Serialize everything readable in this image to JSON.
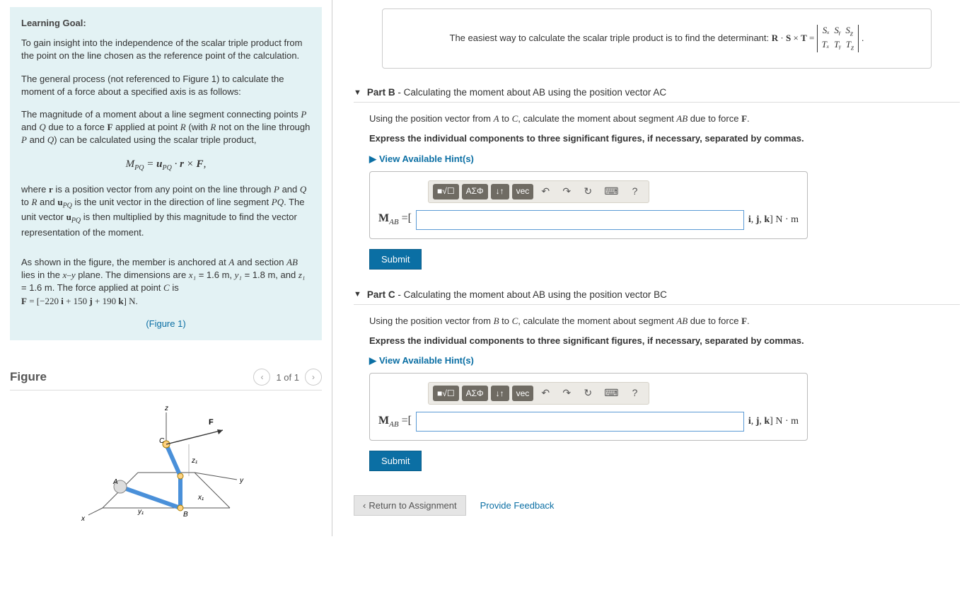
{
  "left": {
    "heading": "Learning Goal:",
    "p1": "To gain insight into the independence of the scalar triple product from the point on the line chosen as the reference point of the calculation.",
    "p2": "The general process (not referenced to Figure 1) to calculate the moment of a force about a specified axis is as follows:",
    "p3a": "The magnitude of a moment about a line segment connecting points ",
    "p3b": " and ",
    "p3c": " due to a force ",
    "p3d": " applied at point ",
    "p3e": " (with ",
    "p3f": " not on the line through ",
    "p3g": " and ",
    "p3h": ") can be calculated using the scalar triple product,",
    "it_P": "P",
    "it_Q": "Q",
    "it_R": "R",
    "it_F": "F",
    "formula": "M_{PQ} = u_{PQ} · r × F,",
    "p4a": "where ",
    "p4b": " is a position vector from any point on the line through ",
    "p4c": " to ",
    "p4d": " and ",
    "p4e": " is the unit vector in the direction of line segment ",
    "p4f": ". The unit vector ",
    "p4g": " is then multiplied by this magnitude to find the vector representation of the moment.",
    "it_r": "r",
    "it_PQ": "PQ",
    "it_uPQ": "u_{PQ}",
    "p5a": "As shown in the figure, the member is anchored at ",
    "p5b": " and section ",
    "p5c": " lies in the ",
    "p5d": " plane. The dimensions are ",
    "p5e": " = 1.6 m, ",
    "p5f": " = 1.8 m, and ",
    "p5g": " = 1.6 m. The force applied at point ",
    "p5h": " is",
    "it_A": "A",
    "it_AB": "AB",
    "it_xy": "x–y",
    "it_x1": "x₁",
    "it_y1": "y₁",
    "it_z1": "z₁",
    "it_C": "C",
    "force_eq": "F = [−220 i + 150 j + 190 k] N.",
    "figure_link": "(Figure 1)",
    "figure_title": "Figure",
    "pager": "1 of 1"
  },
  "right": {
    "hint_intro": "The easiest way to calculate the scalar triple product is to find the determinant: ",
    "hint_eq": "R · S × T =",
    "det_row1": [
      "Sₓ",
      "Sᵧ",
      "S_z"
    ],
    "det_row2": [
      "Tₓ",
      "Tᵧ",
      "T_z"
    ],
    "partB": {
      "label": "Part B",
      "title": " - Calculating the moment about AB using the position vector AC",
      "q_a": "Using the position vector from ",
      "q_b": " to ",
      "q_c": ", calculate the moment about segment ",
      "q_d": " due to force ",
      "q_e": ".",
      "it_A": "A",
      "it_C": "C",
      "it_AB": "AB",
      "it_F": "F",
      "instr": "Express the individual components to three significant figures, if necessary, separated by commas.",
      "hints": "View Available Hint(s)",
      "lhs_main": "M",
      "lhs_sub": "AB",
      "lhs_eq": " =[",
      "unit": "i, j, k] N · m",
      "submit": "Submit"
    },
    "partC": {
      "label": "Part C",
      "title": " - Calculating the moment about AB using the position vector BC",
      "q_a": "Using the position vector from ",
      "q_b": " to ",
      "q_c": ", calculate the moment about segment ",
      "q_d": " due to force ",
      "q_e": ".",
      "it_B": "B",
      "it_C": "C",
      "it_AB": "AB",
      "it_F": "F",
      "instr": "Express the individual components to three significant figures, if necessary, separated by commas.",
      "hints": "View Available Hint(s)",
      "lhs_main": "M",
      "lhs_sub": "AB",
      "lhs_eq": " =[",
      "unit": "i, j, k] N · m",
      "submit": "Submit"
    },
    "toolbar": {
      "tmpl": "■√☐",
      "greek": "ΑΣΦ",
      "arrows": "↓↑",
      "vec": "vec",
      "undo": "↶",
      "redo": "↷",
      "reset": "↻",
      "kbd": "⌨",
      "help": "?"
    },
    "return": "Return to Assignment",
    "feedback": "Provide Feedback"
  }
}
